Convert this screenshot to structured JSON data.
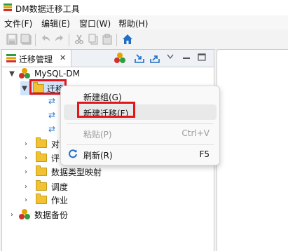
{
  "window": {
    "title": "DM数据迁移工具"
  },
  "menubar": {
    "items": [
      "文件(F)",
      "编辑(E)",
      "窗口(W)",
      "帮助(H)"
    ]
  },
  "view": {
    "tab_label": "迁移管理",
    "close_glyph": "✕"
  },
  "tree": {
    "root": "MySQL-DM",
    "migration_folder_partial": "迁移",
    "partial_folder_1": "对",
    "partial_folder_2": "评",
    "datatype_mapping": "数据类型映射",
    "schedule": "调度",
    "job": "作业",
    "backup": "数据备份"
  },
  "context_menu": {
    "new_group": "新建组(G)",
    "new_migration": "新建迁移(F)",
    "paste": "粘贴(P)",
    "paste_shortcut": "Ctrl+V",
    "refresh": "刷新(R)",
    "refresh_shortcut": "F5"
  },
  "colors": {
    "highlight": "#e0161b",
    "accent": "#2b7bd6",
    "folder": "#f1c232"
  }
}
